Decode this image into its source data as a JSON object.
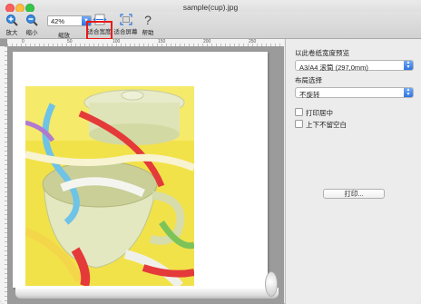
{
  "window": {
    "title": "sample(cup).jpg"
  },
  "toolbar": {
    "zoom_in_label": "放大",
    "zoom_out_label": "缩小",
    "zoom_value": "42%",
    "zoom_caption": "缩放",
    "fit_width_label": "适合宽度",
    "fit_screen_label": "适合屏幕",
    "help_label": "帮助"
  },
  "rulers": {
    "h_marks": [
      "0",
      "50",
      "100",
      "150",
      "200",
      "250"
    ]
  },
  "sidebar": {
    "preview_label": "以此卷纸宽度预览",
    "paper_value": "A3/A4 滚筒 (297,0mm)",
    "layout_label": "布局选择",
    "layout_value": "不旋转",
    "center_print_label": "打印居中",
    "no_margin_label": "上下不留空白",
    "print_button": "打印..."
  },
  "colors": {
    "highlight": "#e81a1a",
    "accent": "#2f73e0"
  }
}
